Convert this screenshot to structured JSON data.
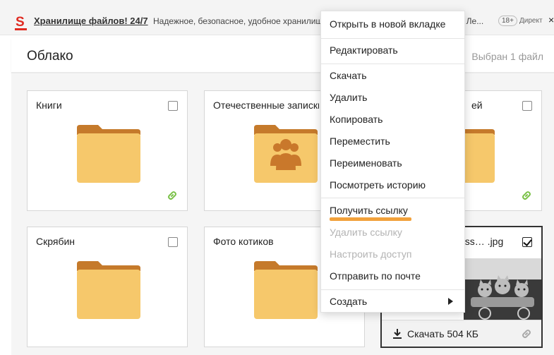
{
  "ad": {
    "logo": "S",
    "title": "Хранилище файлов! 24/7",
    "text": "Надежное, безопасное, удобное хранилище",
    "tail": "! Ле...",
    "age": "18+",
    "direct": "Директ",
    "close": "×"
  },
  "header": {
    "title": "Облако",
    "selected_info": "Выбран 1 файл"
  },
  "cards": [
    {
      "name": "Книги",
      "type": "folder"
    },
    {
      "name": "Отечественные записки",
      "type": "folder-shared"
    },
    {
      "name": "ей",
      "type": "folder"
    },
    {
      "name": "Скрябин",
      "type": "folder"
    },
    {
      "name": "Фото котиков",
      "type": "folder"
    },
    {
      "name": "ess… .jpg",
      "type": "image",
      "download_label": "Скачать 504 КБ"
    }
  ],
  "menu": {
    "items": [
      {
        "label": "Открыть в новой вкладке"
      },
      {
        "label": "Редактировать"
      },
      {
        "label": "Скачать"
      },
      {
        "label": "Удалить"
      },
      {
        "label": "Копировать"
      },
      {
        "label": "Переместить"
      },
      {
        "label": "Переименовать"
      },
      {
        "label": "Посмотреть историю"
      },
      {
        "label": "Получить ссылку"
      },
      {
        "label": "Удалить ссылку",
        "disabled": true
      },
      {
        "label": "Настроить доступ",
        "disabled": true
      },
      {
        "label": "Отправить по почте"
      },
      {
        "label": "Создать"
      }
    ]
  },
  "colors": {
    "folder": "#f6c86b",
    "folder_tab": "#c57a2b",
    "shared_icon": "#c9782b",
    "link": "#7cc24a",
    "highlight": "#f2a13b",
    "logo": "#e02a21"
  },
  "icons": [
    "close-icon",
    "folder-icon",
    "shared-folder-icon",
    "link-icon",
    "download-icon",
    "submenu-arrow-icon"
  ]
}
